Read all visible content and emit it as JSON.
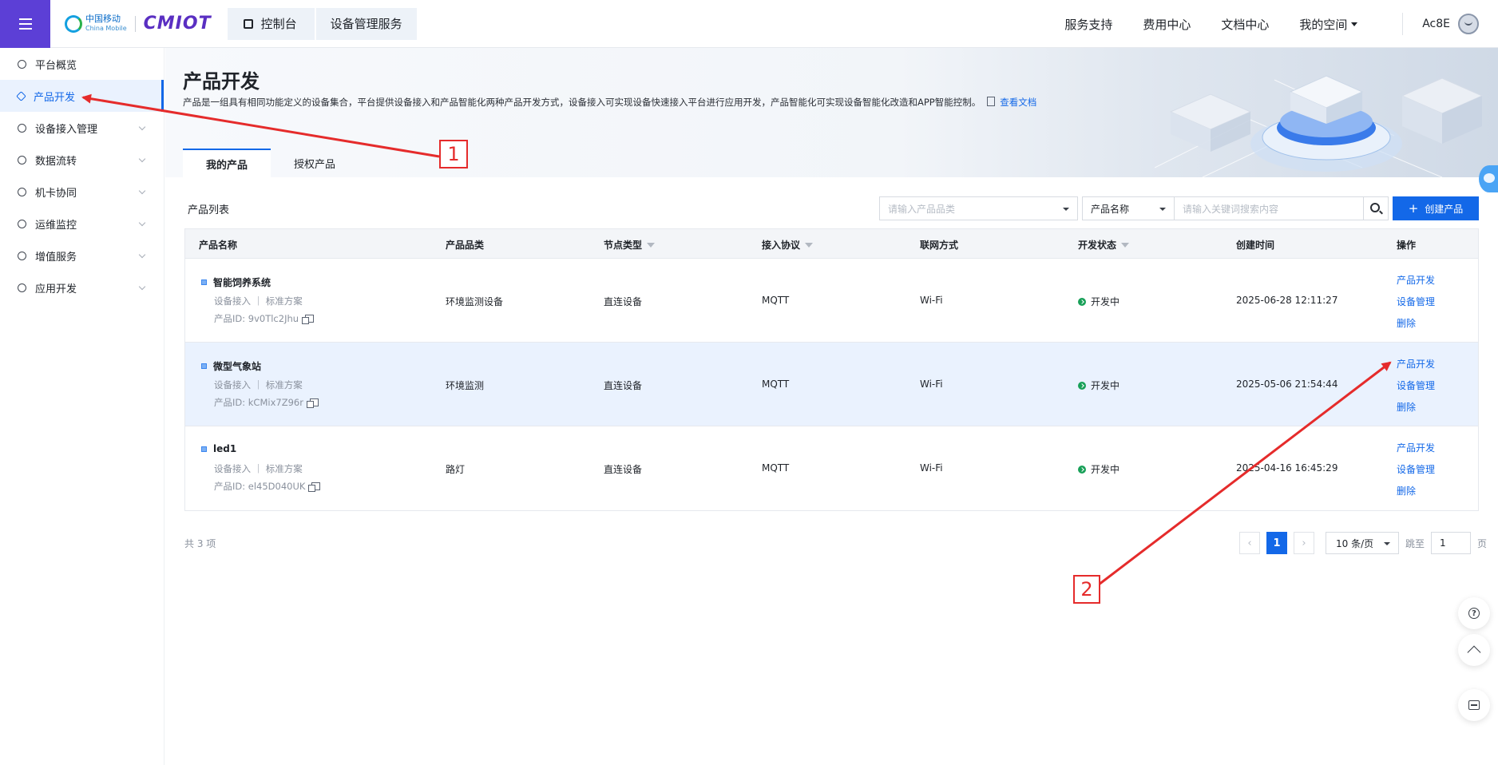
{
  "header": {
    "brand_cn": "中国移动",
    "brand_en": "China Mobile",
    "product_logo": "CMIOT",
    "breadcrumbs": [
      "控制台",
      "设备管理服务"
    ],
    "nav": [
      "服务支持",
      "费用中心",
      "文档中心",
      "我的空间"
    ],
    "user": "Ac8E"
  },
  "sidebar": {
    "items": [
      {
        "label": "平台概览",
        "icon": "overview-icon",
        "expandable": false
      },
      {
        "label": "产品开发",
        "icon": "product-cube-icon",
        "expandable": false,
        "active": true
      },
      {
        "label": "设备接入管理",
        "icon": "device-access-icon",
        "expandable": true
      },
      {
        "label": "数据流转",
        "icon": "data-flow-icon",
        "expandable": true
      },
      {
        "label": "机卡协同",
        "icon": "card-sync-icon",
        "expandable": true
      },
      {
        "label": "运维监控",
        "icon": "monitor-icon",
        "expandable": true
      },
      {
        "label": "增值服务",
        "icon": "value-service-icon",
        "expandable": true
      },
      {
        "label": "应用开发",
        "icon": "app-dev-icon",
        "expandable": true
      }
    ]
  },
  "hero": {
    "title": "产品开发",
    "description": "产品是一组具有相同功能定义的设备集合，平台提供设备接入和产品智能化两种产品开发方式，设备接入可实现设备快速接入平台进行应用开发，产品智能化可实现设备智能化改造和APP智能控制。",
    "doc_link": "查看文档"
  },
  "tabs": [
    "我的产品",
    "授权产品"
  ],
  "list": {
    "title": "产品列表",
    "category_placeholder": "请输入产品品类",
    "search_field": "产品名称",
    "search_placeholder": "请输入关键词搜索内容",
    "create_label": "创建产品"
  },
  "table": {
    "columns": [
      "产品名称",
      "产品品类",
      "节点类型",
      "接入协议",
      "联网方式",
      "开发状态",
      "创建时间",
      "操作"
    ],
    "rows": [
      {
        "name": "智能饲养系统",
        "sub": "设备接入 ｜ 标准方案",
        "pid": "产品ID:  9v0Tlc2Jhu",
        "category": "环境监测设备",
        "node": "直连设备",
        "protocol": "MQTT",
        "network": "Wi-Fi",
        "status": "开发中",
        "created": "2025-06-28 12:11:27",
        "ops": [
          "产品开发",
          "设备管理",
          "删除"
        ]
      },
      {
        "name": "微型气象站",
        "sub": "设备接入 ｜ 标准方案",
        "pid": "产品ID:  kCMix7Z96r",
        "category": "环境监测",
        "node": "直连设备",
        "protocol": "MQTT",
        "network": "Wi-Fi",
        "status": "开发中",
        "created": "2025-05-06 21:54:44",
        "ops": [
          "产品开发",
          "设备管理",
          "删除"
        ]
      },
      {
        "name": "led1",
        "sub": "设备接入 ｜ 标准方案",
        "pid": "产品ID:  el45D040UK",
        "category": "路灯",
        "node": "直连设备",
        "protocol": "MQTT",
        "network": "Wi-Fi",
        "status": "开发中",
        "created": "2025-04-16 16:45:29",
        "ops": [
          "产品开发",
          "设备管理",
          "删除"
        ]
      }
    ]
  },
  "pagination": {
    "total": "共 3 项",
    "prev": "‹",
    "current": "1",
    "next": "›",
    "page_size": "10 条/页",
    "jump_label": "跳至",
    "jump_value": "1",
    "page_unit": "页"
  },
  "annotations": [
    "1",
    "2"
  ],
  "colors": {
    "accent": "#1368e8",
    "menu_bg": "#5c3fd6",
    "annotation": "#e52b2b",
    "status_ok": "#18a058"
  }
}
